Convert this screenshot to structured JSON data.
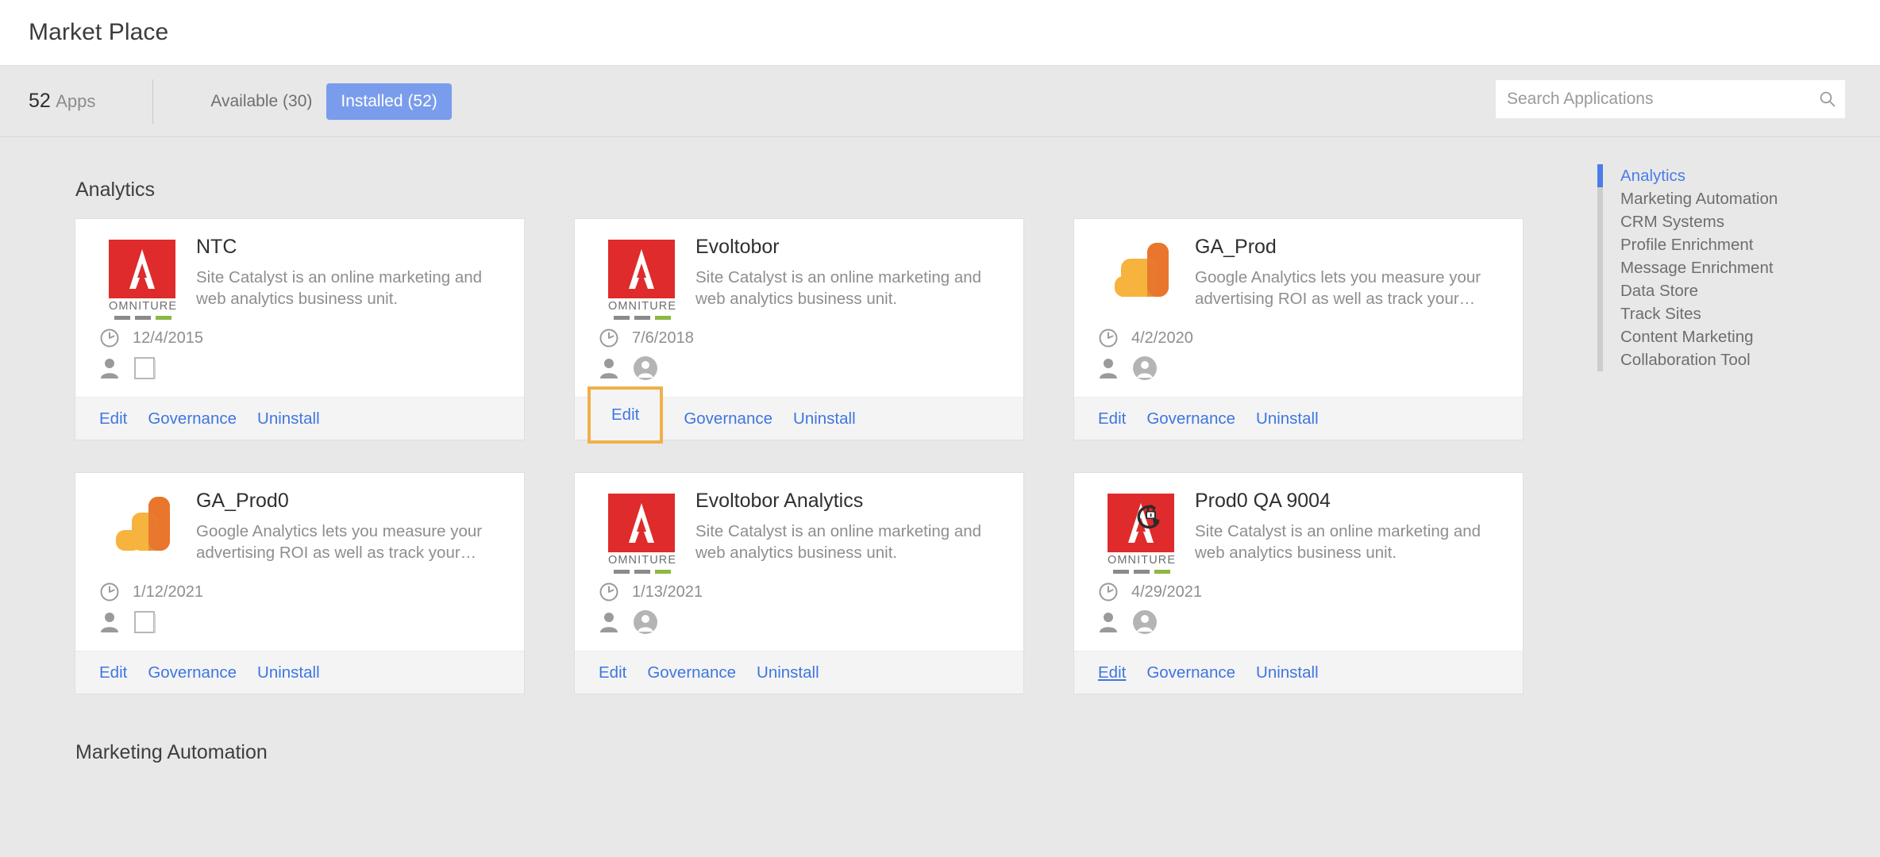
{
  "header": {
    "title": "Market Place"
  },
  "toolbar": {
    "app_count": "52",
    "app_count_label": "Apps",
    "tabs": [
      {
        "label": "Available (30)",
        "active": false
      },
      {
        "label": "Installed (52)",
        "active": true
      }
    ],
    "search": {
      "placeholder": "Search Applications",
      "value": "",
      "icon": "search-icon"
    },
    "accent_color": "#7a9ced"
  },
  "sections": [
    {
      "title": "Analytics"
    },
    {
      "title": "Marketing Automation"
    }
  ],
  "card_actions": {
    "edit": "Edit",
    "governance": "Governance",
    "uninstall": "Uninstall"
  },
  "cards": [
    {
      "name": "NTC",
      "description": "Site Catalyst is an online marketing and web analytics business unit.",
      "date": "12/4/2015",
      "logo": "omniture-logo",
      "owner_icon": "person-icon",
      "secondary_icon": "broken-image-placeholder-icon",
      "edit_state": "normal"
    },
    {
      "name": "Evoltobor",
      "description": "Site Catalyst is an online marketing and web analytics business unit.",
      "date": "7/6/2018",
      "logo": "omniture-logo",
      "owner_icon": "person-icon",
      "secondary_icon": "avatar-circle-icon",
      "edit_state": "focused"
    },
    {
      "name": "GA_Prod",
      "description": "Google Analytics lets you measure your advertising ROI as well as track your…",
      "date": "4/2/2020",
      "logo": "google-analytics-logo",
      "owner_icon": "person-icon",
      "secondary_icon": "avatar-circle-icon",
      "edit_state": "normal"
    },
    {
      "name": "GA_Prod0",
      "description": "Google Analytics lets you measure your advertising ROI as well as track your…",
      "date": "1/12/2021",
      "logo": "google-analytics-logo",
      "owner_icon": "person-icon",
      "secondary_icon": "broken-image-placeholder-icon",
      "edit_state": "normal"
    },
    {
      "name": "Evoltobor Analytics",
      "description": "Site Catalyst is an online marketing and web analytics business unit.",
      "date": "1/13/2021",
      "logo": "omniture-logo",
      "owner_icon": "person-icon",
      "secondary_icon": "avatar-circle-icon",
      "edit_state": "normal"
    },
    {
      "name": "Prod0 QA 9004",
      "description": "Site Catalyst is an online marketing and web analytics business unit.",
      "date": "4/29/2021",
      "logo": "omniture-logo",
      "owner_icon": "person-icon",
      "secondary_icon": "avatar-circle-icon",
      "edit_state": "hover"
    }
  ],
  "right_nav": {
    "items": [
      {
        "label": "Analytics",
        "active": true
      },
      {
        "label": "Marketing Automation",
        "active": false
      },
      {
        "label": "CRM Systems",
        "active": false
      },
      {
        "label": "Profile Enrichment",
        "active": false
      },
      {
        "label": "Message Enrichment",
        "active": false
      },
      {
        "label": "Data Store",
        "active": false
      },
      {
        "label": "Track Sites",
        "active": false
      },
      {
        "label": "Content Marketing",
        "active": false
      },
      {
        "label": "Collaboration Tool",
        "active": false
      }
    ],
    "active_color": "#4c7ce8",
    "inactive_color": "#6e6e6e"
  },
  "logos": {
    "omniture_wordmark": "OMNITURE",
    "omniture_red": "#df2b2b",
    "ga_yellow": "#f6b33d",
    "ga_orange": "#e8762c"
  },
  "cursor": {
    "icon": "pointer-with-lock-cursor"
  },
  "focus_ring_color": "#f0b04a"
}
